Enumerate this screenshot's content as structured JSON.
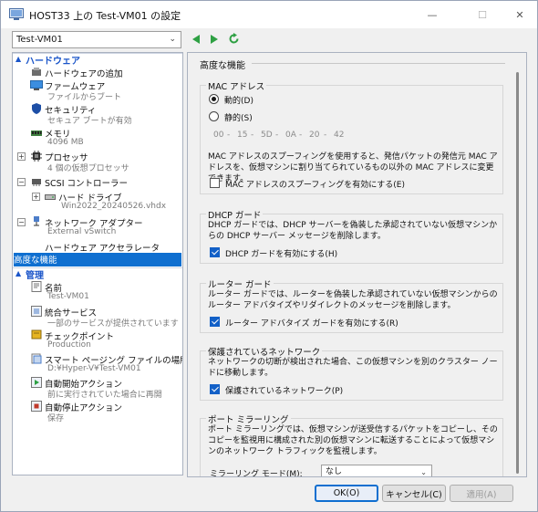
{
  "window": {
    "title": "HOST33 上の Test-VM01 の設定"
  },
  "toolbar": {
    "vm_selected": "Test-VM01"
  },
  "tree": {
    "hardware_header": "ハードウェア",
    "management_header": "管理",
    "items": [
      {
        "label": "ハードウェアの追加",
        "sub": ""
      },
      {
        "label": "ファームウェア",
        "sub": "ファイルからブート"
      },
      {
        "label": "セキュリティ",
        "sub": "セキュア ブートが有効"
      },
      {
        "label": "メモリ",
        "sub": "4096 MB"
      },
      {
        "label": "プロセッサ",
        "sub": "4 個の仮想プロセッサ"
      },
      {
        "label": "SCSI コントローラー",
        "sub": ""
      },
      {
        "label": "ハード ドライブ",
        "sub": "Win2022_20240526.vhdx"
      },
      {
        "label": "ネットワーク アダプター",
        "sub": "External vSwitch"
      },
      {
        "label": "ハードウェア アクセラレータ",
        "sub": ""
      },
      {
        "label": "高度な機能",
        "sub": ""
      },
      {
        "label": "名前",
        "sub": "Test-VM01"
      },
      {
        "label": "統合サービス",
        "sub": "一部のサービスが提供されています"
      },
      {
        "label": "チェックポイント",
        "sub": "Production"
      },
      {
        "label": "スマート ページング ファイルの場所",
        "sub": "D:¥Hyper-V¥Test-VM01"
      },
      {
        "label": "自動開始アクション",
        "sub": "前に実行されていた場合に再開"
      },
      {
        "label": "自動停止アクション",
        "sub": "保存"
      }
    ]
  },
  "content": {
    "heading": "高度な機能",
    "mac": {
      "title": "MAC アドレス",
      "dynamic_label": "動的(D)",
      "static_label": "静的(S)",
      "octets": [
        "00",
        "15",
        "5D",
        "0A",
        "20",
        "42"
      ],
      "spoof_desc": "MAC アドレスのスプーフィングを使用すると、発信パケットの発信元 MAC アドレスを、仮想マシンに割り当てられているもの以外の MAC アドレスに変更できます。",
      "spoof_label": "MAC アドレスのスプーフィングを有効にする(E)"
    },
    "dhcp": {
      "title": "DHCP ガード",
      "desc": "DHCP ガードでは、DHCP サーバーを偽装した承認されていない仮想マシンからの DHCP サーバー メッセージを削除します。",
      "checkbox_label": "DHCP ガードを有効にする(H)"
    },
    "router": {
      "title": "ルーター ガード",
      "desc": "ルーター ガードでは、ルーターを偽装した承認されていない仮想マシンからのルーター アドバタイズやリダイレクトのメッセージを削除します。",
      "checkbox_label": "ルーター アドバタイズ ガードを有効にする(R)"
    },
    "protected": {
      "title": "保護されているネットワーク",
      "desc": "ネットワークの切断が検出された場合、この仮想マシンを別のクラスター ノードに移動します。",
      "checkbox_label": "保護されているネットワーク(P)"
    },
    "mirroring": {
      "title": "ポート ミラーリング",
      "desc": "ポート ミラーリングでは、仮想マシンが送受信するパケットをコピーし、そのコピーを監視用に構成された別の仮想マシンに転送することによって仮想マシンのネットワーク トラフィックを監視します。",
      "mode_label": "ミラーリング モード(M):",
      "mode_value": "なし"
    }
  },
  "footer": {
    "ok": "OK(O)",
    "cancel": "キャンセル(C)",
    "apply": "適用(A)"
  },
  "colors": {
    "accent": "#0f6fd0",
    "header_text": "#1a55c9"
  }
}
